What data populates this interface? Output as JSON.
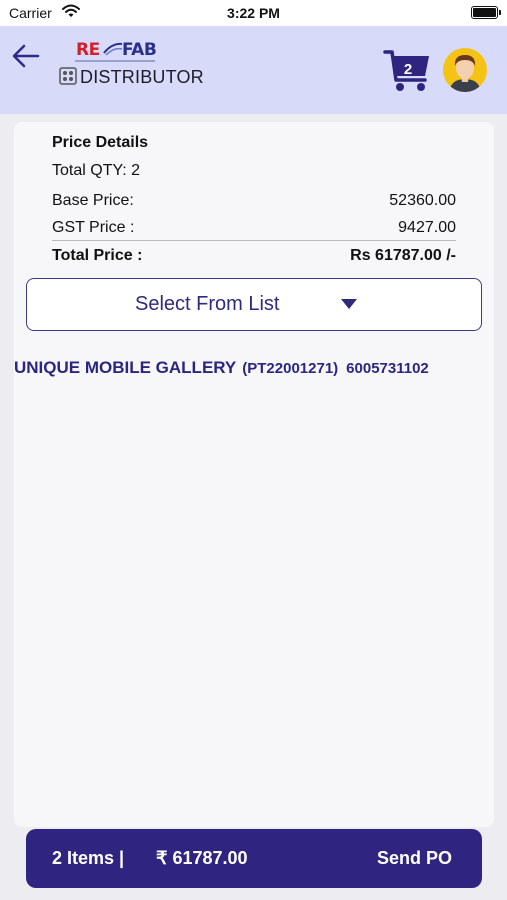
{
  "status_bar": {
    "carrier": "Carrier",
    "time": "3:22 PM"
  },
  "header": {
    "logo_re": "RE",
    "logo_fab": "FAB",
    "subtitle": "DISTRIBUTOR",
    "cart_count": "2"
  },
  "price_details": {
    "title": "Price Details",
    "total_qty": "Total QTY: 2",
    "base_label": "Base Price:",
    "base_value": "52360.00",
    "gst_label": "GST Price :",
    "gst_value": "9427.00",
    "total_label": "Total Price :",
    "total_value": "Rs 61787.00 /-"
  },
  "select": {
    "label": "Select From List"
  },
  "shop": {
    "name": "UNIQUE MOBILE GALLERY",
    "code": "(PT22001271)",
    "phone": "6005731102"
  },
  "footer": {
    "items": "2 Items |",
    "amount": "₹ 61787.00",
    "send": "Send PO"
  },
  "colors": {
    "header_bg": "#d7daf8",
    "primary": "#2f2580",
    "accent": "#2d2b7a",
    "avatar_bg": "#f5c316",
    "logo_red": "#d0202e"
  }
}
